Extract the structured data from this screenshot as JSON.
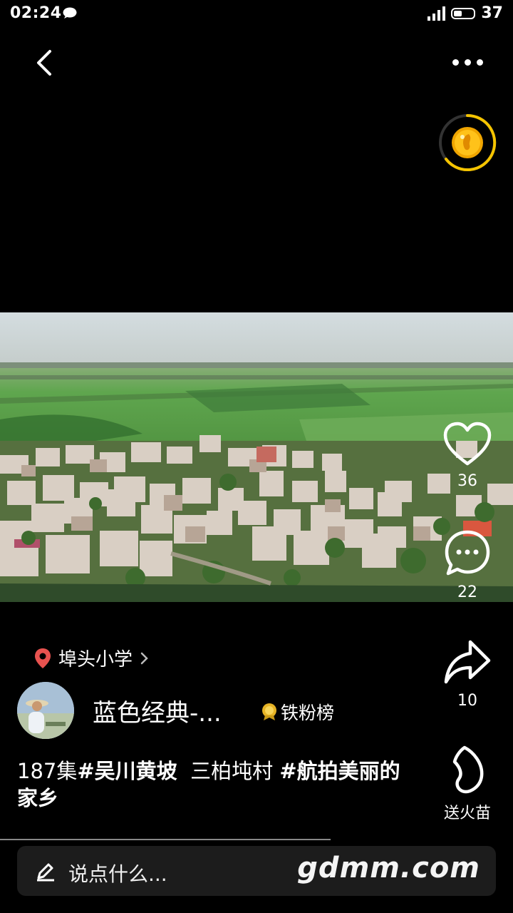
{
  "status_bar": {
    "time": "02:24",
    "network": "4G",
    "battery": "37"
  },
  "icons": {
    "back": "back-arrow-icon",
    "more": "more-dots-icon",
    "coin": "gold-coin-icon",
    "like": "heart-icon",
    "comment": "comment-icon",
    "share": "share-icon",
    "gift": "flame-seedling-icon",
    "location": "location-pin-icon",
    "edit": "pencil-icon"
  },
  "actions": {
    "likes": "36",
    "comments": "22",
    "shares": "10",
    "gift_label": "送火苗"
  },
  "location": {
    "name": "埠头小学"
  },
  "author": {
    "name": "蓝色经典-...",
    "badge": "铁粉榜"
  },
  "description": {
    "part1": "187集",
    "tag1": "#吴川黄坡",
    "part2": "  三柏坉村 ",
    "tag2": "#航拍美丽的家乡"
  },
  "comment_box": {
    "placeholder": "说点什么...",
    "watermark": "gdmm.com"
  },
  "colors": {
    "accent_yellow": "#f5c400",
    "pin_red": "#e8524f"
  }
}
